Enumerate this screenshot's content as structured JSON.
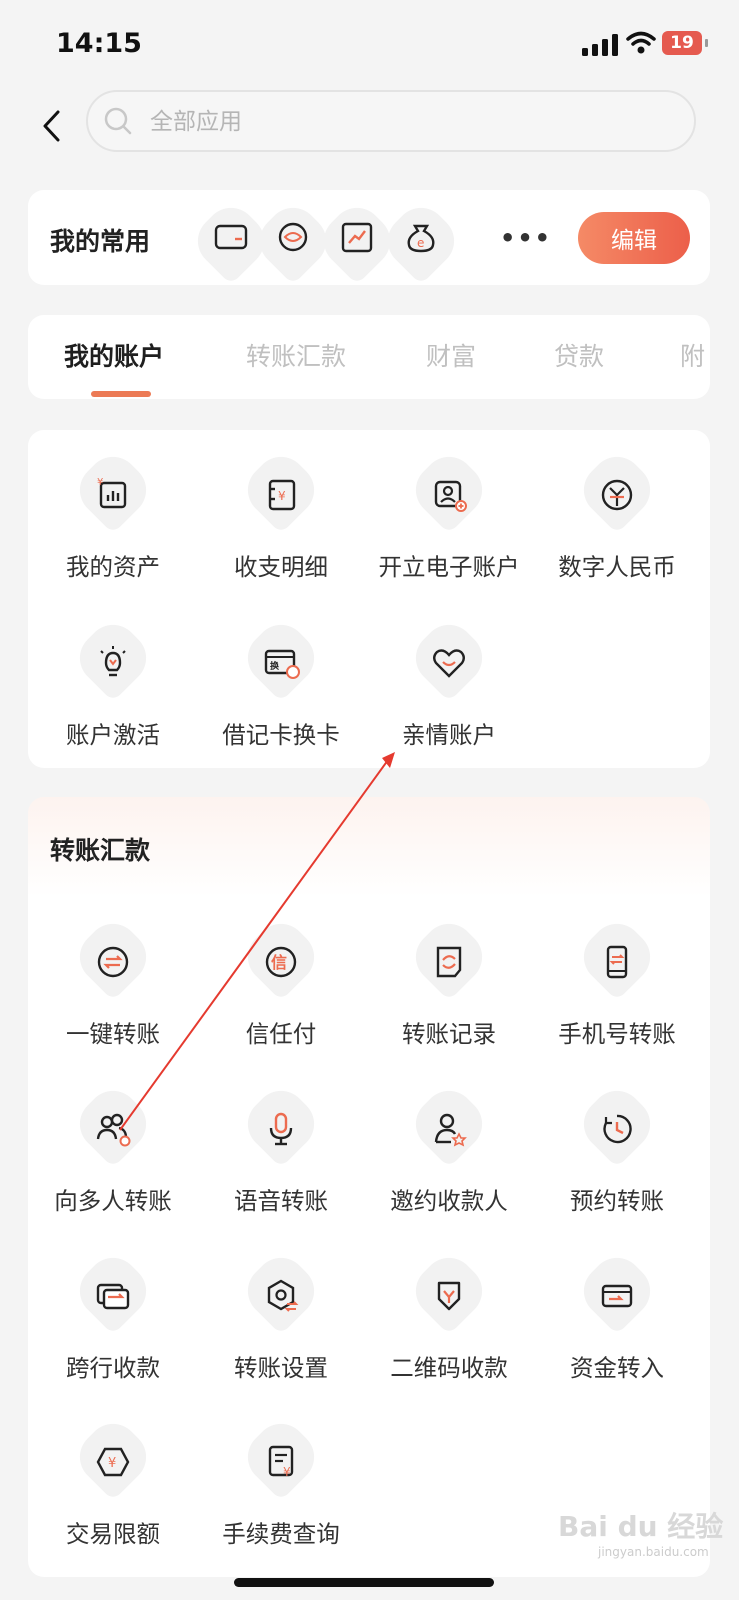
{
  "status_bar": {
    "time": "14:15",
    "battery": "19"
  },
  "search": {
    "placeholder": "全部应用"
  },
  "favorites": {
    "title": "我的常用",
    "more": "•••",
    "edit_label": "编辑"
  },
  "tabs": [
    {
      "label": "我的账户"
    },
    {
      "label": "转账汇款"
    },
    {
      "label": "财富"
    },
    {
      "label": "贷款"
    },
    {
      "label": "附"
    }
  ],
  "account_items": [
    {
      "label": "我的资产",
      "icon": "asset-chart-icon"
    },
    {
      "label": "收支明细",
      "icon": "bill-detail-icon"
    },
    {
      "label": "开立电子账户",
      "icon": "open-account-icon"
    },
    {
      "label": "数字人民币",
      "icon": "digital-rmb-icon"
    },
    {
      "label": "账户激活",
      "icon": "bulb-icon"
    },
    {
      "label": "借记卡换卡",
      "icon": "card-swap-icon"
    },
    {
      "label": "亲情账户",
      "icon": "heart-icon"
    }
  ],
  "transfer": {
    "title": "转账汇款",
    "items": [
      {
        "label": "一键转账",
        "icon": "one-tap-transfer-icon"
      },
      {
        "label": "信任付",
        "icon": "trust-pay-icon"
      },
      {
        "label": "转账记录",
        "icon": "transfer-record-icon"
      },
      {
        "label": "手机号转账",
        "icon": "phone-transfer-icon"
      },
      {
        "label": "向多人转账",
        "icon": "multi-user-icon"
      },
      {
        "label": "语音转账",
        "icon": "microphone-icon"
      },
      {
        "label": "邀约收款人",
        "icon": "invite-payee-icon"
      },
      {
        "label": "预约转账",
        "icon": "clock-icon"
      },
      {
        "label": "跨行收款",
        "icon": "cross-bank-icon"
      },
      {
        "label": "转账设置",
        "icon": "settings-icon"
      },
      {
        "label": "二维码收款",
        "icon": "qr-receive-icon"
      },
      {
        "label": "资金转入",
        "icon": "fund-in-icon"
      },
      {
        "label": "交易限额",
        "icon": "limit-icon"
      },
      {
        "label": "手续费查询",
        "icon": "fee-query-icon"
      }
    ]
  },
  "colors": {
    "accent": "#ec7a55",
    "arrow": "#e53a2f"
  },
  "watermark": {
    "logo": "Bai du 经验",
    "url": "jingyan.baidu.com"
  }
}
